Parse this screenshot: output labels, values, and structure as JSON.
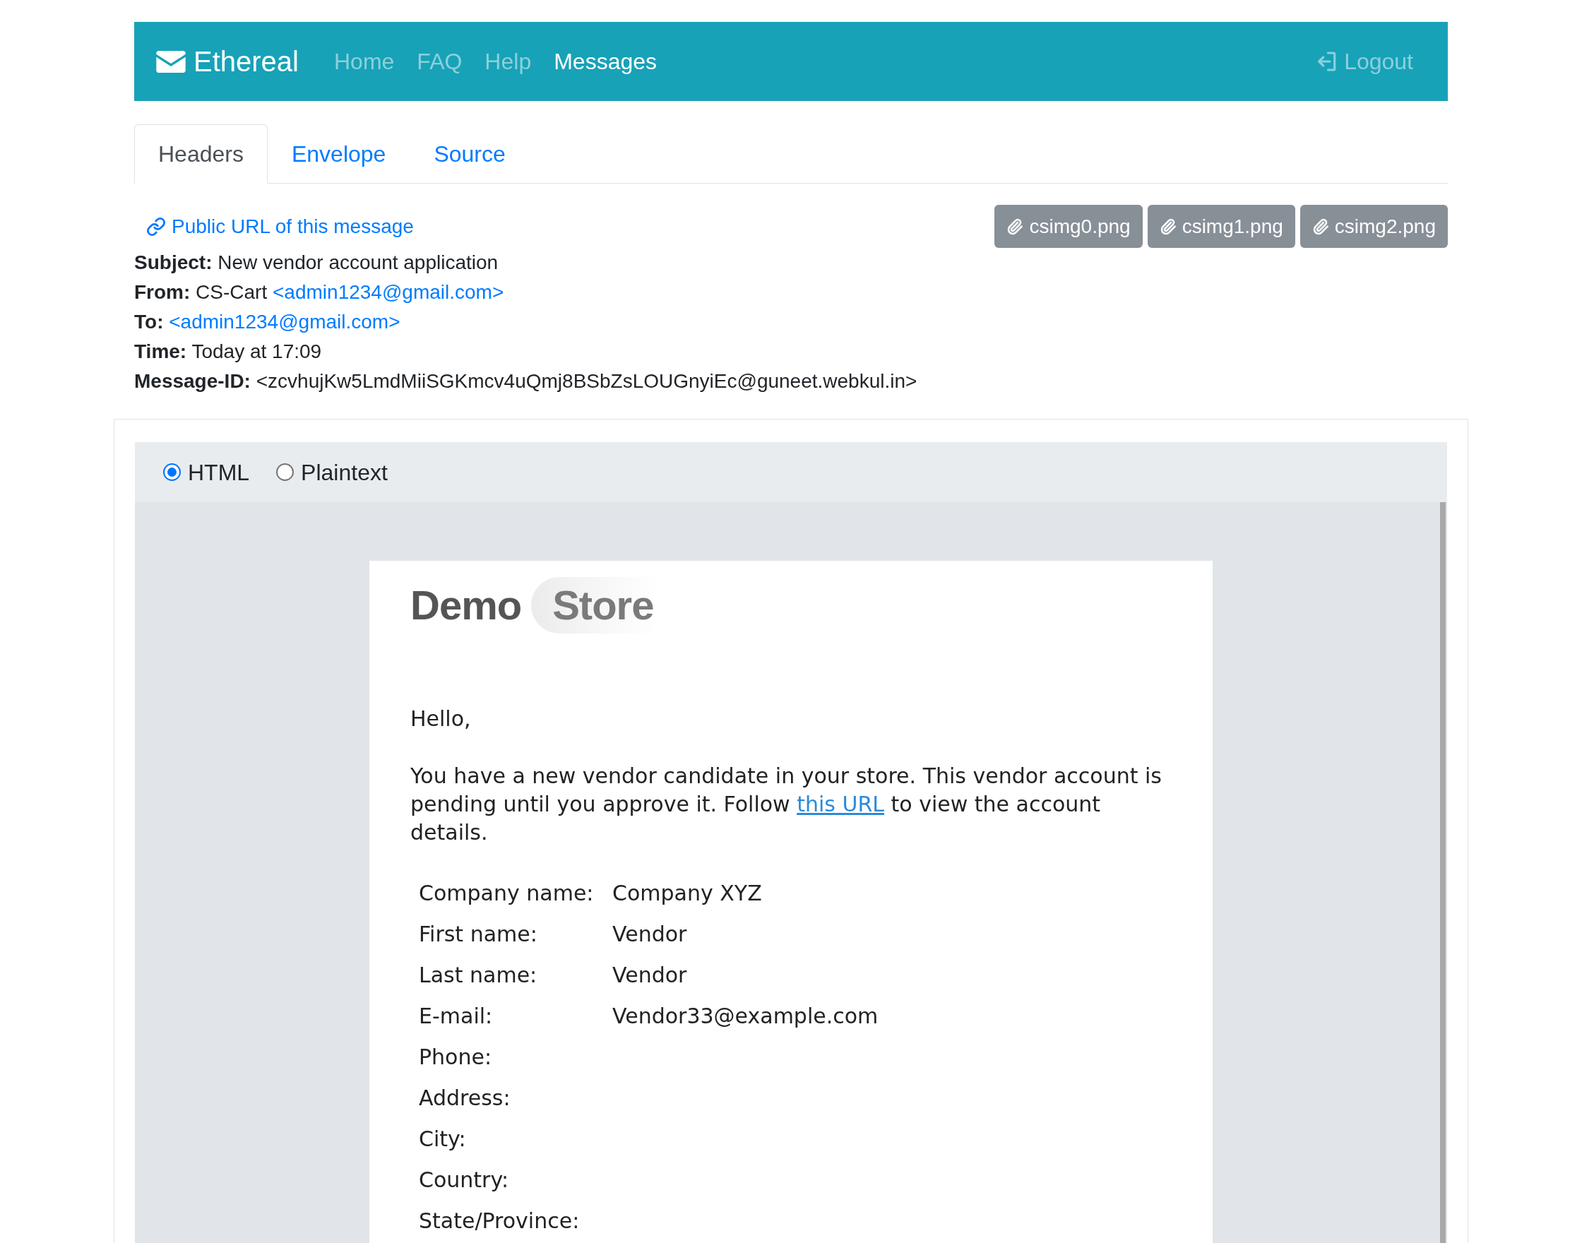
{
  "navbar": {
    "brand": "Ethereal",
    "links": [
      {
        "label": "Home",
        "selected": false
      },
      {
        "label": "FAQ",
        "selected": false
      },
      {
        "label": "Help",
        "selected": false
      },
      {
        "label": "Messages",
        "selected": true
      }
    ],
    "logout": "Logout"
  },
  "tabs": [
    {
      "label": "Headers",
      "selected": true
    },
    {
      "label": "Envelope",
      "selected": false
    },
    {
      "label": "Source",
      "selected": false
    }
  ],
  "public_url": "Public URL of this message",
  "attachments": [
    "csimg0.png",
    "csimg1.png",
    "csimg2.png"
  ],
  "headers": [
    {
      "label": "Subject:",
      "value": "New vendor account application"
    },
    {
      "label": "From:",
      "value": "CS-Cart",
      "link": "<admin1234@gmail.com>"
    },
    {
      "label": "To:",
      "link": "<admin1234@gmail.com>"
    },
    {
      "label": "Time:",
      "value": "Today at 17:09"
    },
    {
      "label": "Message-ID:",
      "value": "<zcvhujKw5LmdMiiSGKmcv4uQmj8BSbZsLOUGnyiEc@guneet.webkul.in>"
    }
  ],
  "view_options": [
    {
      "label": "HTML",
      "selected": true
    },
    {
      "label": "Plaintext",
      "selected": false
    }
  ],
  "email": {
    "logo": {
      "text": "Demo",
      "highlight": "Store"
    },
    "greeting": "Hello,",
    "paragraph": {
      "before": "You have a new vendor candidate in your store. This vendor account is pending until you approve it. Follow",
      "link": "this URL",
      "after": "to view the account details."
    },
    "details": [
      {
        "label": "Company name:",
        "value": "Company XYZ"
      },
      {
        "label": "First name:",
        "value": "Vendor"
      },
      {
        "label": "Last name:",
        "value": "Vendor"
      },
      {
        "label": "E-mail:",
        "value": "Vendor33@example.com"
      },
      {
        "label": "Phone:"
      },
      {
        "label": "Address:"
      },
      {
        "label": "City:"
      },
      {
        "label": "Country:"
      },
      {
        "label": "State/Province:"
      }
    ]
  }
}
